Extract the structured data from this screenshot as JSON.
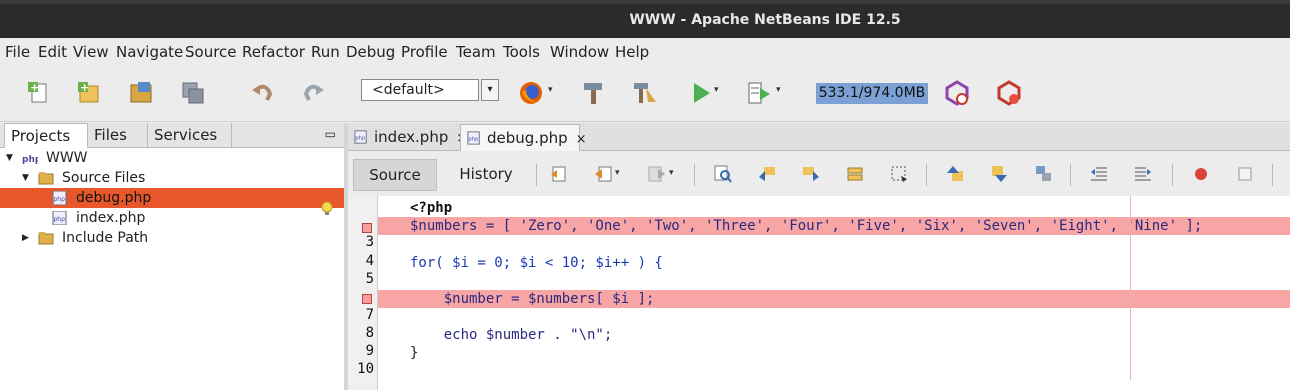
{
  "window": {
    "title": "WWW - Apache NetBeans IDE 12.5"
  },
  "menu": [
    "File",
    "Edit",
    "View",
    "Navigate",
    "Source",
    "Refactor",
    "Run",
    "Debug",
    "Profile",
    "Team",
    "Tools",
    "Window",
    "Help"
  ],
  "toolbar": {
    "config_value": "<default>",
    "memory": "533.1/974.0MB",
    "icons": [
      "new-file-icon",
      "new-project-icon",
      "open-project-icon",
      "save-all-icon",
      "undo-icon",
      "redo-icon",
      "firefox-icon",
      "build-icon",
      "clean-build-icon",
      "run-icon",
      "debug-icon",
      "profile-icon",
      "profile-attach-icon"
    ]
  },
  "left_panel": {
    "tabs": [
      "Projects",
      "Files",
      "Services"
    ],
    "minimize": "▭",
    "tree": [
      {
        "label": "WWW",
        "level": 0,
        "expanded": true,
        "icon": "php-project-icon"
      },
      {
        "label": "Source Files",
        "level": 1,
        "expanded": true,
        "icon": "folder-icon"
      },
      {
        "label": "debug.php",
        "level": 2,
        "selected": true,
        "icon": "php-file-icon"
      },
      {
        "label": "index.php",
        "level": 2,
        "icon": "php-file-icon"
      },
      {
        "label": "Include Path",
        "level": 1,
        "expanded": false,
        "icon": "folder-icon"
      }
    ]
  },
  "editor": {
    "tabs": [
      {
        "label": "index.php",
        "close": "×",
        "active": false
      },
      {
        "label": "debug.php",
        "close": "×",
        "active": true
      }
    ],
    "source_label": "Source",
    "history_label": "History",
    "line_numbers": [
      "",
      "",
      "3",
      "4",
      "5",
      "",
      "7",
      "8",
      "9",
      "10"
    ],
    "lines": [
      "<?php",
      "$numbers = [ 'Zero', 'One', 'Two', 'Three', 'Four', 'Five', 'Six', 'Seven', 'Eight', 'Nine' ];",
      "",
      "for( $i = 0; $i < 10; $i++ ) {",
      "",
      "    $number = $numbers[ $i ];",
      "",
      "    echo $number . \"\\n\";",
      "}",
      ""
    ],
    "breakpoint_lines": [
      2,
      6
    ],
    "colors": {
      "breakpoint": "#f7a5a5",
      "selection": "#e8572a",
      "memory": "#7ba1d4"
    }
  }
}
